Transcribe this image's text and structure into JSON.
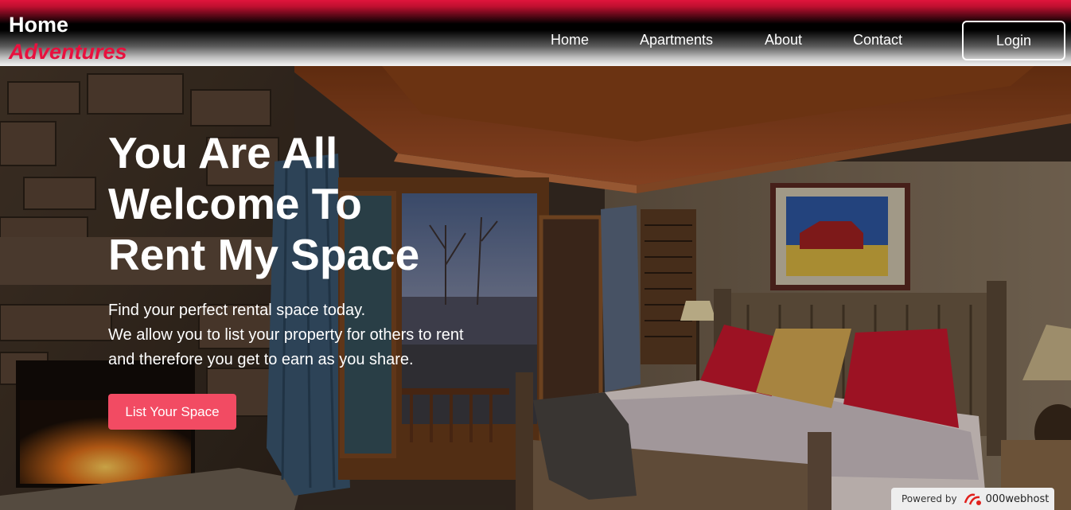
{
  "header": {
    "logo_line1": "Home",
    "logo_line2": "Adventures",
    "nav": [
      {
        "label": "Home"
      },
      {
        "label": "Apartments"
      },
      {
        "label": "About"
      },
      {
        "label": "Contact"
      }
    ],
    "login_label": "Login"
  },
  "hero": {
    "title_lines": [
      "You Are All",
      "Welcome To",
      "Rent My Space"
    ],
    "subtitle_lines": [
      "Find your perfect rental space today.",
      "We allow you to list your property for others to rent",
      "and therefore you get to earn as you share."
    ],
    "cta_label": "List Your Space",
    "background": "bedroom-interior-photo"
  },
  "badge": {
    "prefix": "Powered by",
    "brand": "000webhost",
    "icon": "webhost-logo-icon"
  },
  "colors": {
    "accent_red": "#e8103e",
    "cta_pink": "#f24b63",
    "header_top": "#e0143c"
  }
}
